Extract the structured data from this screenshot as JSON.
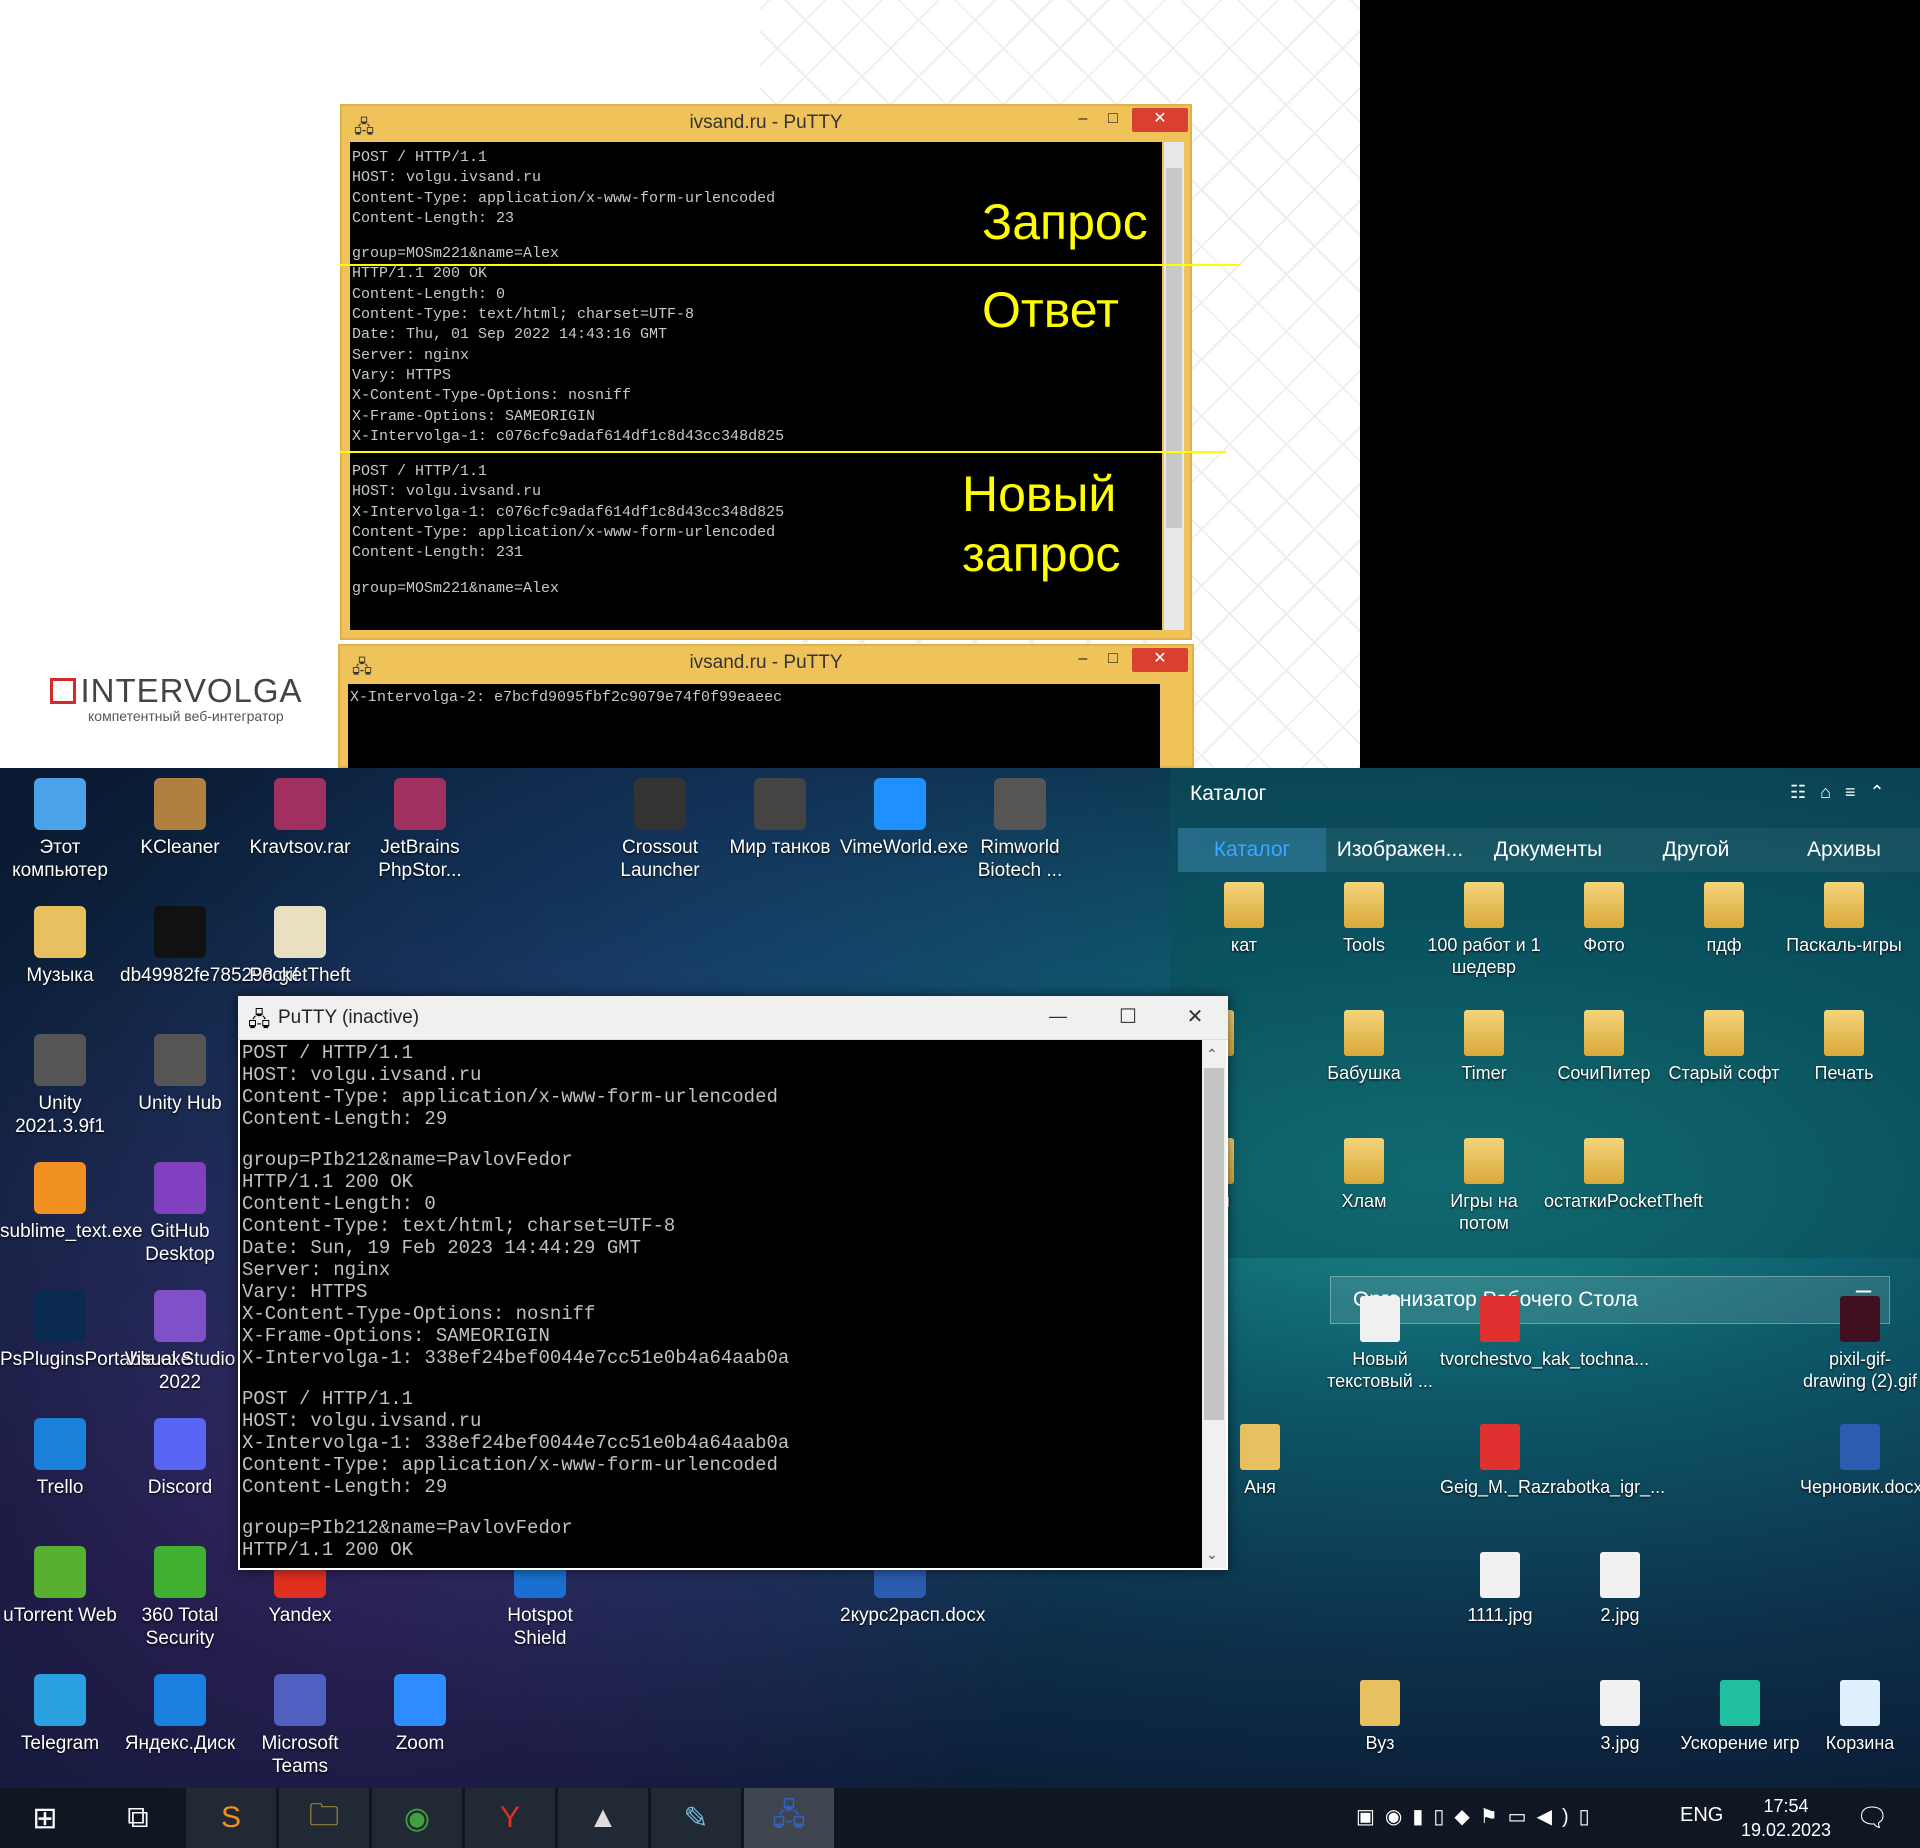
{
  "slide": {
    "window1": {
      "title": "ivsand.ru - PuTTY",
      "lines": [
        "POST / HTTP/1.1",
        "HOST: volgu.ivsand.ru",
        "Content-Type: application/x-www-form-urlencoded",
        "Content-Length: 23",
        "",
        "group=MOSm221&name=Alex",
        "HTTP/1.1 200 OK",
        "Content-Length: 0",
        "Content-Type: text/html; charset=UTF-8",
        "Date: Thu, 01 Sep 2022 14:43:16 GMT",
        "Server: nginx",
        "Vary: HTTPS",
        "X-Content-Type-Options: nosniff",
        "X-Frame-Options: SAMEORIGIN",
        "X-Intervolga-1: c076cfc9adaf614df1c8d43cc348d825",
        "",
        "POST / HTTP/1.1",
        "HOST: volgu.ivsand.ru",
        "X-Intervolga-1: c076cfc9adaf614df1c8d43cc348d825",
        "Content-Type: application/x-www-form-urlencoded",
        "Content-Length: 231",
        "",
        "group=MOSm221&name=Alex"
      ]
    },
    "window2": {
      "title": "ivsand.ru - PuTTY",
      "lines": [
        "X-Intervolga-2: e7bcfd9095fbf2c9079e74f0f99eaeec"
      ]
    },
    "annotations": {
      "request": "Запрос",
      "response": "Ответ",
      "new_request_1": "Новый",
      "new_request_2": "запрос"
    },
    "logo": {
      "name": "INTERVOLGA",
      "tagline": "компетентный веб-интегратор"
    },
    "minimize": "–",
    "maximize": "□",
    "close": "✕"
  },
  "putty": {
    "title": "PuTTY (inactive)",
    "minimize": "—",
    "maximize": "☐",
    "close": "✕",
    "lines": [
      "POST / HTTP/1.1",
      "HOST: volgu.ivsand.ru",
      "Content-Type: application/x-www-form-urlencoded",
      "Content-Length: 29",
      "",
      "group=PIb212&name=PavlovFedor",
      "HTTP/1.1 200 OK",
      "Content-Length: 0",
      "Content-Type: text/html; charset=UTF-8",
      "Date: Sun, 19 Feb 2023 14:44:29 GMT",
      "Server: nginx",
      "Vary: HTTPS",
      "X-Content-Type-Options: nosniff",
      "X-Frame-Options: SAMEORIGIN",
      "X-Intervolga-1: 338ef24bef0044e7cc51e0b4a64aab0a",
      "",
      "POST / HTTP/1.1",
      "HOST: volgu.ivsand.ru",
      "X-Intervolga-1: 338ef24bef0044e7cc51e0b4a64aab0a",
      "Content-Type: application/x-www-form-urlencoded",
      "Content-Length: 29",
      "",
      "group=PIb212&name=PavlovFedor",
      "HTTP/1.1 200 OK"
    ]
  },
  "desktop_icons": [
    {
      "label": "Этот компьютер",
      "icon": "computer-icon",
      "color": "#4aa3e8"
    },
    {
      "label": "KCleaner",
      "icon": "broom-icon",
      "color": "#b08040"
    },
    {
      "label": "Kravtsov.rar",
      "icon": "rar-icon",
      "color": "#a03060"
    },
    {
      "label": "JetBrains PhpStor...",
      "icon": "rar-icon",
      "color": "#a03060"
    },
    {
      "label": "Crossout Launcher",
      "icon": "crossout-icon",
      "color": "#333333"
    },
    {
      "label": "Мир танков",
      "icon": "tank-icon",
      "color": "#444444"
    },
    {
      "label": "VimeWorld.exe",
      "icon": "vimeworld-icon",
      "color": "#1e90ff"
    },
    {
      "label": "Rimworld Biotech ...",
      "icon": "rimworld-icon",
      "color": "#555555"
    },
    {
      "label": "Музыка",
      "icon": "folder-icon",
      "color": "#e8c060"
    },
    {
      "label": "db49982fe785298.gif",
      "icon": "gif-icon",
      "color": "#111111"
    },
    {
      "label": "PocketTheft",
      "icon": "pockettheft-icon",
      "color": "#e8e0c0"
    },
    {
      "label": "Unity 2021.3.9f1",
      "icon": "unity-icon",
      "color": "#555555"
    },
    {
      "label": "Unity Hub",
      "icon": "unity-hub-icon",
      "color": "#555555"
    },
    {
      "label": "sublime_text.exe",
      "icon": "sublime-icon",
      "color": "#f09020"
    },
    {
      "label": "GitHub Desktop",
      "icon": "github-icon",
      "color": "#8040c0"
    },
    {
      "label": "PsPluginsPortable.exe",
      "icon": "photoshop-icon",
      "color": "#0a2a50"
    },
    {
      "label": "Visual Studio 2022",
      "icon": "visual-studio-icon",
      "color": "#8050c8"
    },
    {
      "label": "Trello",
      "icon": "trello-icon",
      "color": "#1a80d8"
    },
    {
      "label": "Discord",
      "icon": "discord-icon",
      "color": "#5865f2"
    },
    {
      "label": "uTorrent Web",
      "icon": "utorrent-icon",
      "color": "#58b030"
    },
    {
      "label": "360 Total Security",
      "icon": "360-icon",
      "color": "#40b030"
    },
    {
      "label": "Yandex",
      "icon": "yandex-icon",
      "color": "#e03020"
    },
    {
      "label": "Hotspot Shield",
      "icon": "hotspot-icon",
      "color": "#1a70d0"
    },
    {
      "label": "2курс2расп.docx",
      "icon": "word-icon",
      "color": "#2a5cb0"
    },
    {
      "label": "Telegram",
      "icon": "telegram-icon",
      "color": "#2aa0e0"
    },
    {
      "label": "Яндекс.Диск",
      "icon": "yandex-disk-icon",
      "color": "#1a80e0"
    },
    {
      "label": "Microsoft Teams",
      "icon": "teams-icon",
      "color": "#5060c0"
    },
    {
      "label": "Zoom",
      "icon": "zoom-icon",
      "color": "#2d8cff"
    }
  ],
  "catalog": {
    "title": "Каталог",
    "tabs": [
      "Каталог",
      "Изображен...",
      "Документы",
      "Другой",
      "Архивы"
    ],
    "items": [
      "кат",
      "Tools",
      "100 работ и 1 шедевр",
      "Фото",
      "пдф",
      "Паскаль-игры",
      "nity",
      "Бабушка",
      "Timer",
      "СочиПитер",
      "Старый софт",
      "Печать",
      "нсы",
      "Хлам",
      "Игры на потом",
      "остаткиPocketTheft"
    ]
  },
  "organizer": {
    "title": "Организатор Рабочего Стола",
    "items": [
      "Новый текстовый ...",
      "tvorchestvo_kak_tochna...",
      "pixil-gif-drawing (2).gif",
      "Аня",
      "Geig_M._Razrabotka_igr_...",
      "Черновик.docx",
      "1111.jpg",
      "2.jpg",
      "Вуз",
      "3.jpg",
      "Ускорение игр",
      "Корзина"
    ]
  },
  "taskbar": {
    "apps": [
      "start-icon",
      "task-view-icon",
      "sublime-icon",
      "explorer-icon",
      "chrome-icon",
      "yandex-browser-icon",
      "photos-icon",
      "notepad-icon",
      "putty-icon"
    ],
    "lang": "ENG",
    "time": "17:54",
    "date": "19.02.2023"
  }
}
